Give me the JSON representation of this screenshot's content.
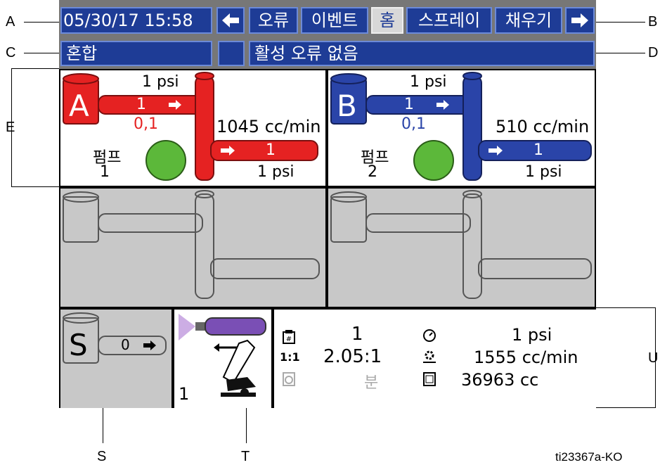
{
  "header": {
    "datetime": "05/30/17 15:58",
    "back_arrow": "🡄",
    "tabs": [
      "오류",
      "이벤트",
      "홈",
      "스프레이",
      "채우기"
    ],
    "forward_arrow": "🡆"
  },
  "status": {
    "mode": "혼합",
    "message": "활성 오류 없음"
  },
  "pump_a": {
    "letter": "A",
    "inlet_psi": "1 psi",
    "flow_value": "1",
    "ratio": "0,1",
    "flow_rate": "1045 cc/min",
    "pump_label": "펌프",
    "pump_number": "1",
    "outlet_value": "1",
    "outlet_psi": "1 psi",
    "color": "#e52222"
  },
  "pump_b": {
    "letter": "B",
    "inlet_psi": "1 psi",
    "flow_value": "1",
    "ratio": "0,1",
    "flow_rate": "510 cc/min",
    "pump_label": "펌프",
    "pump_number": "2",
    "outlet_value": "1",
    "outlet_psi": "1 psi",
    "color": "#2a44a8"
  },
  "solvent": {
    "letter": "S",
    "value": "0"
  },
  "gun": {
    "number": "1"
  },
  "summary": {
    "recipe": "1",
    "ratio_label": "1:1",
    "ratio": "2.05:1",
    "time_unit": "분",
    "pressure": "1 psi",
    "flow_rate": "1555 cc/min",
    "volume": "36963 cc"
  },
  "callouts": {
    "A": "A",
    "B": "B",
    "C": "C",
    "D": "D",
    "E": "E",
    "S": "S",
    "T": "T",
    "U": "U"
  },
  "figure_id": "ti23367a-KO",
  "colors": {
    "nav_blue": "#1e3c96",
    "pump_red": "#e52222",
    "pump_blue": "#2a44a8",
    "status_green": "#5cb83a",
    "inactive_gray": "#c8c8c8"
  }
}
